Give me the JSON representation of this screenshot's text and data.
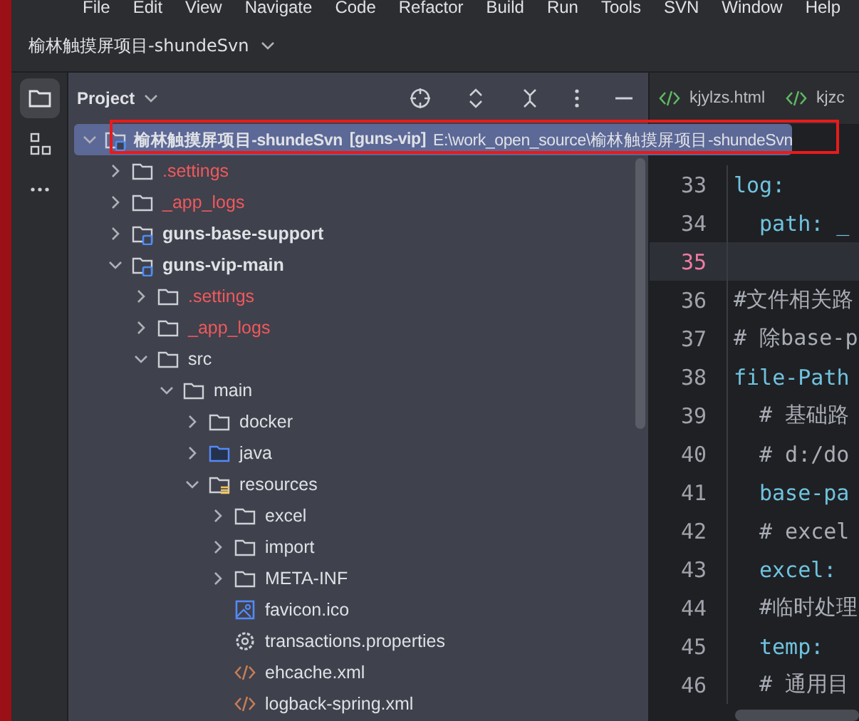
{
  "menu": [
    "File",
    "Edit",
    "View",
    "Navigate",
    "Code",
    "Refactor",
    "Build",
    "Run",
    "Tools",
    "SVN",
    "Window",
    "Help"
  ],
  "project_title": "榆林触摸屏项目-shundeSvn",
  "tool_strip": [
    {
      "kind": "folder",
      "selected": true
    },
    {
      "kind": "structure",
      "selected": false
    },
    {
      "kind": "more",
      "selected": false
    }
  ],
  "panel": {
    "title": "Project"
  },
  "tree": [
    {
      "label": "榆林触摸屏项目-shundeSvn",
      "module": "[guns-vip]",
      "path": "E:\\work_open_source\\榆林触摸屏项目-shundeSvn",
      "kind": "module",
      "selected": true,
      "expanded": true,
      "ignored": false,
      "children": [
        {
          "label": ".settings",
          "kind": "folder",
          "selected": false,
          "expanded": false,
          "ignored": true
        },
        {
          "label": "_app_logs",
          "kind": "folder",
          "selected": false,
          "expanded": false,
          "ignored": true
        },
        {
          "label": "guns-base-support",
          "kind": "module",
          "selected": false,
          "expanded": false,
          "ignored": false
        },
        {
          "label": "guns-vip-main",
          "kind": "module",
          "selected": false,
          "expanded": true,
          "ignored": false,
          "children": [
            {
              "label": ".settings",
              "kind": "folder",
              "selected": false,
              "expanded": false,
              "ignored": true
            },
            {
              "label": "_app_logs",
              "kind": "folder",
              "selected": false,
              "expanded": false,
              "ignored": true
            },
            {
              "label": "src",
              "kind": "folder",
              "selected": false,
              "expanded": true,
              "ignored": false,
              "children": [
                {
                  "label": "main",
                  "kind": "folder",
                  "selected": false,
                  "expanded": true,
                  "ignored": false,
                  "children": [
                    {
                      "label": "docker",
                      "kind": "folder",
                      "selected": false,
                      "expanded": false,
                      "ignored": false
                    },
                    {
                      "label": "java",
                      "kind": "source-folder",
                      "selected": false,
                      "expanded": false,
                      "ignored": false
                    },
                    {
                      "label": "resources",
                      "kind": "resource-folder",
                      "selected": false,
                      "expanded": true,
                      "ignored": false,
                      "children": [
                        {
                          "label": "excel",
                          "kind": "folder",
                          "selected": false,
                          "expanded": false,
                          "ignored": false
                        },
                        {
                          "label": "import",
                          "kind": "folder",
                          "selected": false,
                          "expanded": false,
                          "ignored": false
                        },
                        {
                          "label": "META-INF",
                          "kind": "folder",
                          "selected": false,
                          "expanded": false,
                          "ignored": false
                        },
                        {
                          "label": "favicon.ico",
                          "kind": "image",
                          "selected": false,
                          "ignored": false
                        },
                        {
                          "label": "transactions.properties",
                          "kind": "properties",
                          "selected": false,
                          "ignored": false
                        },
                        {
                          "label": "ehcache.xml",
                          "kind": "xml",
                          "selected": false,
                          "ignored": false
                        },
                        {
                          "label": "logback-spring.xml",
                          "kind": "xml",
                          "selected": false,
                          "ignored": false
                        }
                      ]
                    }
                  ]
                }
              ]
            }
          ]
        }
      ]
    }
  ],
  "editor_tabs": [
    {
      "label": "kjylzs.html",
      "kind": "html"
    },
    {
      "label": "kjzc",
      "kind": "html"
    }
  ],
  "code_lines": [
    {
      "number": "33",
      "text": "log:",
      "kind": "key",
      "indented": false,
      "current": false
    },
    {
      "number": "34",
      "text": "path: _",
      "kind": "key",
      "indented": true,
      "current": false
    },
    {
      "number": "35",
      "kind": "blank",
      "current": true
    },
    {
      "number": "36",
      "text": "#文件相关路",
      "kind": "comment",
      "indented": false,
      "current": false
    },
    {
      "number": "37",
      "text": "# 除base-p",
      "kind": "comment",
      "indented": false,
      "current": false
    },
    {
      "number": "38",
      "text": "file-Path",
      "kind": "key",
      "indented": false,
      "current": false
    },
    {
      "number": "39",
      "text": "# 基础路",
      "kind": "comment",
      "indented": true,
      "current": false
    },
    {
      "number": "40",
      "text": "# d:/do",
      "kind": "comment",
      "indented": true,
      "current": false
    },
    {
      "number": "41",
      "text": "base-pa",
      "kind": "key",
      "indented": true,
      "current": false
    },
    {
      "number": "42",
      "text": "# excel",
      "kind": "comment",
      "indented": true,
      "current": false
    },
    {
      "number": "43",
      "text": "excel:",
      "kind": "key",
      "indented": true,
      "current": false
    },
    {
      "number": "44",
      "text": "#临时处理",
      "kind": "comment",
      "indented": true,
      "current": false
    },
    {
      "number": "45",
      "text": "temp:",
      "kind": "key",
      "indented": true,
      "current": false
    },
    {
      "number": "46",
      "text": "# 通用目",
      "kind": "comment",
      "indented": true,
      "current": false
    }
  ]
}
